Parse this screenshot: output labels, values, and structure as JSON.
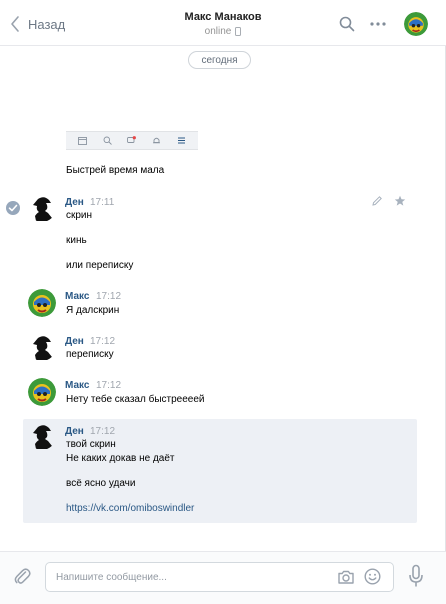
{
  "header": {
    "back_label": "Назад",
    "title": "Макс Манаков",
    "status": "online"
  },
  "date_separator": "сегодня",
  "messages": [
    {
      "text": "Быстрей время мала"
    },
    {
      "author": "Ден",
      "time": "17:11",
      "lines": [
        "скрин",
        "кинь",
        "или переписку"
      ]
    },
    {
      "author": "Макс",
      "time": "17:12",
      "lines": [
        "Я далскрин"
      ]
    },
    {
      "author": "Ден",
      "time": "17:12",
      "lines": [
        "переписку"
      ]
    },
    {
      "author": "Макс",
      "time": "17:12",
      "lines": [
        "Нету тебе сказал быстреееей"
      ]
    },
    {
      "author": "Ден",
      "time": "17:12",
      "lines": [
        "твой скрин",
        "Не каких докав не даёт",
        "всё ясно удачи"
      ],
      "link": "https://vk.com/omiboswindler"
    }
  ],
  "composer": {
    "placeholder": "Напишите сообщение..."
  },
  "icons": {
    "back": "chevron-left-icon",
    "search": "search-icon",
    "more": "more-dots-icon",
    "attach": "paperclip-icon",
    "camera": "camera-icon",
    "emoji": "smile-icon",
    "voice": "microphone-icon",
    "edit": "pencil-icon",
    "favorite": "star-icon",
    "select": "check-circle-icon"
  },
  "colors": {
    "accent": "#2a5885",
    "muted": "#939393",
    "highlight_bg": "#edf0f5",
    "notification_badge": "#e64646"
  }
}
